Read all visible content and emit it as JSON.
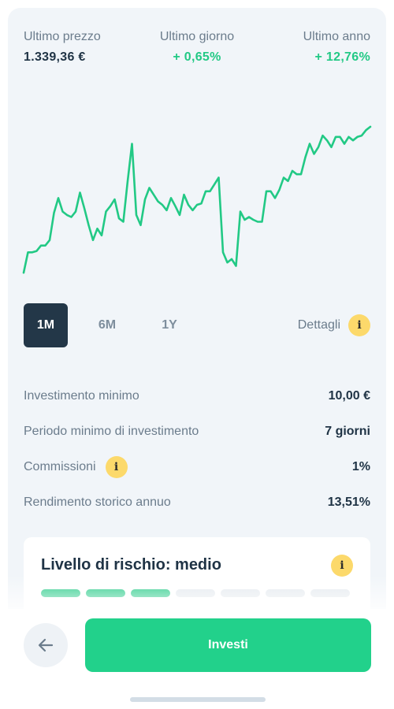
{
  "stats": [
    {
      "label": "Ultimo prezzo",
      "value": "1.339,36 €",
      "tone": "dark"
    },
    {
      "label": "Ultimo giorno",
      "value": "+ 0,65%",
      "tone": "green"
    },
    {
      "label": "Ultimo anno",
      "value": "+ 12,76%",
      "tone": "green"
    }
  ],
  "chart": {
    "line_color": "#22c985",
    "values": [
      30,
      60,
      60,
      62,
      70,
      70,
      78,
      118,
      140,
      120,
      115,
      112,
      120,
      148,
      125,
      100,
      78,
      95,
      85,
      120,
      128,
      138,
      110,
      105,
      165,
      220,
      115,
      100,
      138,
      155,
      145,
      135,
      130,
      122,
      140,
      128,
      115,
      145,
      130,
      122,
      130,
      132,
      150,
      150,
      160,
      170,
      60,
      45,
      50,
      40,
      120,
      108,
      112,
      108,
      105,
      105,
      150,
      150,
      140,
      152,
      170,
      165,
      180,
      175,
      175,
      200,
      220,
      205,
      215,
      232,
      225,
      215,
      230,
      230,
      220,
      230,
      225,
      230,
      232,
      240,
      245
    ],
    "ymin": 0,
    "ymax": 260
  },
  "ranges": [
    {
      "label": "1M",
      "active": true
    },
    {
      "label": "6M",
      "active": false
    },
    {
      "label": "1Y",
      "active": false
    }
  ],
  "details_label": "Dettagli",
  "info_glyph": "i",
  "rows": [
    {
      "label": "Investimento minimo",
      "value": "10,00 €",
      "info": false
    },
    {
      "label": "Periodo minimo di investimento",
      "value": "7 giorni",
      "info": false
    },
    {
      "label": "Commissioni",
      "value": "1%",
      "info": true
    },
    {
      "label": "Rendimento storico annuo",
      "value": "13,51%",
      "info": false
    }
  ],
  "risk": {
    "title": "Livello di rischio: medio",
    "level": 3,
    "total": 7,
    "on_color": "#22c985",
    "off_color": "#e4e9ee"
  },
  "bottom": {
    "invest_label": "Investi",
    "back_icon": "arrow-left-icon"
  },
  "colors": {
    "accent_green": "#22d18b",
    "dark": "#233748",
    "info_yellow": "#fcd96b"
  }
}
